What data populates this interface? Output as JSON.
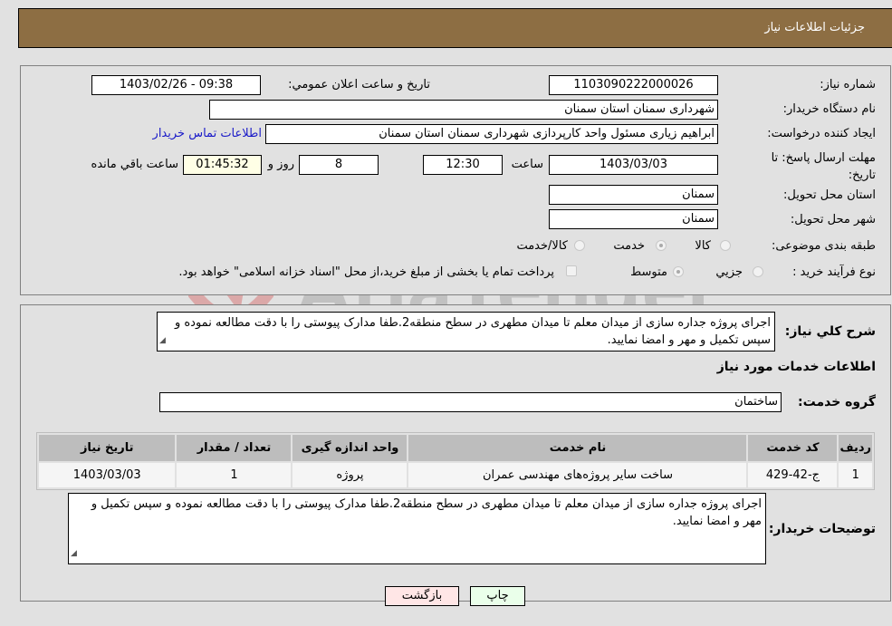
{
  "header": {
    "title": "جزئیات اطلاعات نیاز"
  },
  "details": {
    "need_number": {
      "label": "شماره نیاز:",
      "value": "1103090222000026"
    },
    "announce": {
      "label": "تاريخ و ساعت اعلان عمومي:",
      "value": "1403/02/26 - 09:38"
    },
    "buyer_org": {
      "label": "نام دستگاه خريدار:",
      "value": "شهرداری سمنان استان سمنان"
    },
    "creator": {
      "label": "ايجاد کننده درخواست:",
      "value": "ابراهیم زیاری مسئول واحد کارپردازی شهرداری سمنان استان سمنان",
      "contact_link": "اطلاعات تماس خريدار"
    },
    "deadline": {
      "label": "مهلت ارسال پاسخ: تا تاريخ:",
      "date": "1403/03/03",
      "time_label": "ساعت",
      "time": "12:30",
      "days": "8",
      "days_label": "روز و",
      "remaining": "01:45:32",
      "remaining_label": "ساعت باقي مانده"
    },
    "province": {
      "label": "استان محل تحويل:",
      "value": "سمنان"
    },
    "city": {
      "label": "شهر محل تحويل:",
      "value": "سمنان"
    },
    "category": {
      "label": "طبقه بندی موضوعی:",
      "options": [
        {
          "label": "کالا",
          "checked": false
        },
        {
          "label": "خدمت",
          "checked": true
        },
        {
          "label": "کالا/خدمت",
          "checked": false
        }
      ]
    },
    "purchase_type": {
      "label": "نوع فرآيند خريد :",
      "options": [
        {
          "label": "جزيي",
          "checked": false
        },
        {
          "label": "متوسط",
          "checked": true
        }
      ],
      "treasury_note": "پرداخت تمام يا بخشی از مبلغ خريد،از محل \"اسناد خزانه اسلامی\" خواهد بود."
    }
  },
  "summary": {
    "label": "شرح کلي نياز:",
    "text": "اجرای پروژه جداره سازی از میدان معلم تا میدان مطهری در سطح منطقه2.طفا مدارک پیوستی را با دقت مطالعه نموده و سپس تکمیل و مهر و امضا نمایید."
  },
  "services": {
    "section_title": "اطلاعات خدمات مورد نياز",
    "group_label": "گروه خدمت:",
    "group_value": "ساختمان",
    "columns": [
      "رديف",
      "کد خدمت",
      "نام خدمت",
      "واحد اندازه گيری",
      "تعداد / مقدار",
      "تاريخ نياز"
    ],
    "rows": [
      [
        "1",
        "ج-42-429",
        "ساخت سایر پروژه‌های مهندسی عمران",
        "پروژه",
        "1",
        "1403/03/03"
      ]
    ]
  },
  "buyer_notes": {
    "label": "توضيحات خريدار:",
    "text": "اجرای پروژه جداره سازی از میدان معلم تا میدان مطهری در سطح منطقه2.طفا مدارک پیوستی را با دقت مطالعه نموده و سپس تکمیل و مهر و امضا نمایید."
  },
  "buttons": {
    "print": "چاپ",
    "back": "بازگشت"
  },
  "watermark": {
    "text": "AriaTender.neT"
  },
  "colors": {
    "header_bg": "#8d6e43",
    "print_bg": "#eaffea",
    "back_bg": "#ffe6e6",
    "link": "#1a1ac8"
  }
}
